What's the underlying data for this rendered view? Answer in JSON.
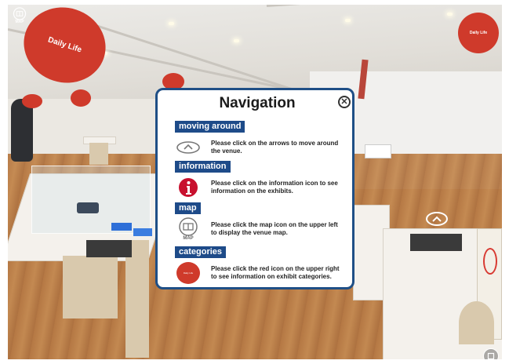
{
  "topbar": {
    "map_button_label": "MAP",
    "category_badge": "Daily Life"
  },
  "scene": {
    "balloon_label": "Daily Life"
  },
  "modal": {
    "title": "Navigation",
    "sections": [
      {
        "heading": "moving around",
        "icon": "arrow-up-icon",
        "text": "Please click on the arrows to move around the venue."
      },
      {
        "heading": "information",
        "icon": "info-icon",
        "text": "Please click on the information icon to see information on the exhibits."
      },
      {
        "heading": "map",
        "icon": "map-icon",
        "icon_label": "MAP",
        "text": "Please click the map icon on the upper left to display the venue map."
      },
      {
        "heading": "categories",
        "icon": "category-icon",
        "icon_label": "Daily Life",
        "text": "Please click the red icon on the upper right to see information on exhibit categories."
      }
    ]
  },
  "colors": {
    "accent": "#1e4b89",
    "category_red": "#cf3a2b",
    "info_red": "#c8102e"
  }
}
